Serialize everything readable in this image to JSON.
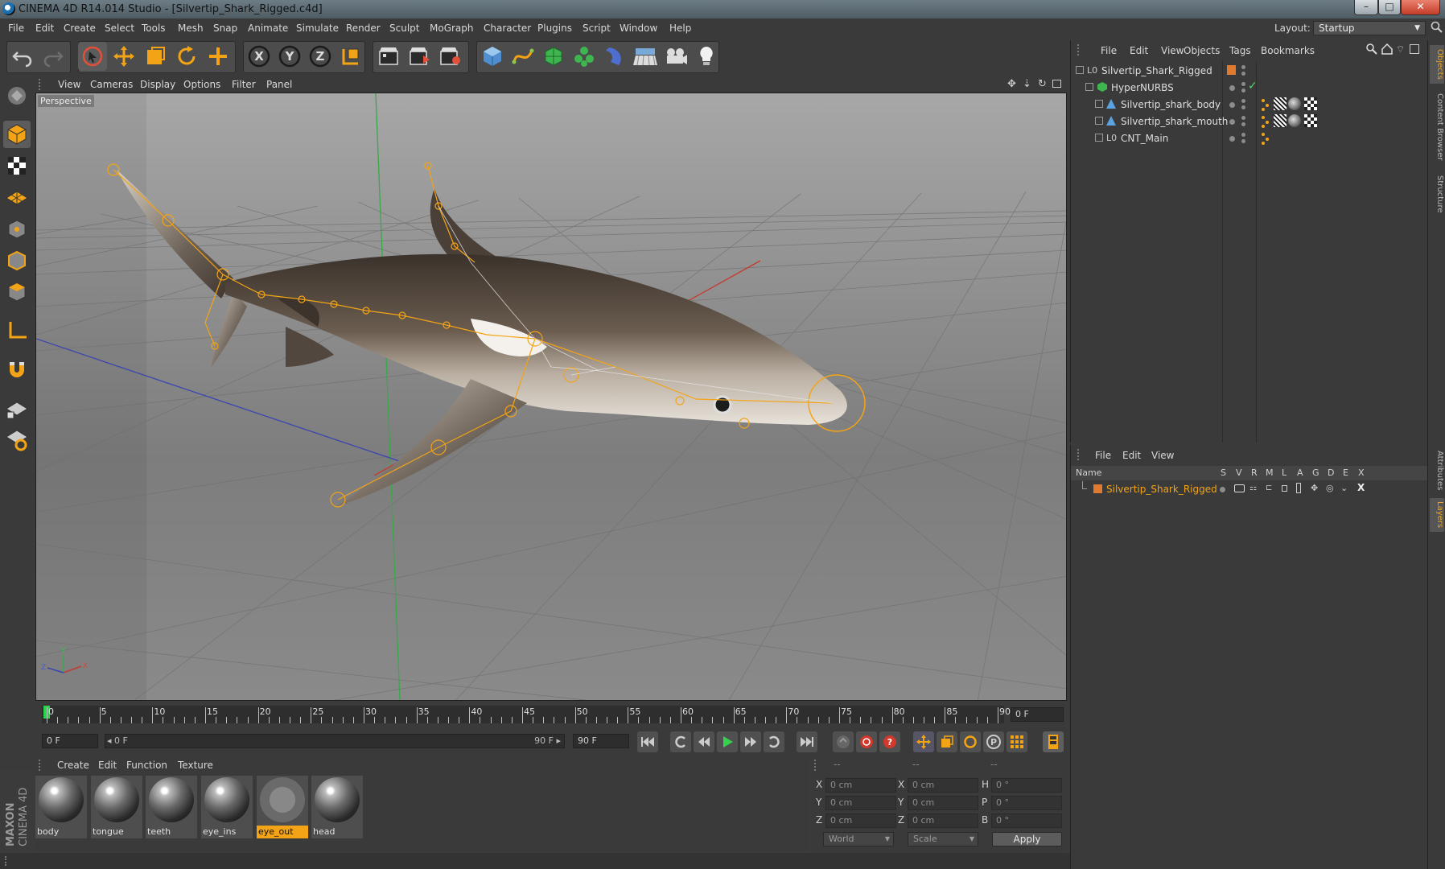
{
  "window": {
    "title": "CINEMA 4D R14.014 Studio - [Silvertip_Shark_Rigged.c4d]",
    "minimize_label": "–",
    "maximize_label": "□",
    "close_label": "✕"
  },
  "menubar": {
    "items": [
      "File",
      "Edit",
      "Create",
      "Select",
      "Tools",
      "Mesh",
      "Snap",
      "Animate",
      "Simulate",
      "Render",
      "Sculpt",
      "MoGraph",
      "Character",
      "Plugins",
      "Script",
      "Window",
      "Help"
    ],
    "layout_label": "Layout:",
    "layout_value": "Startup"
  },
  "toolbar": {
    "icons": [
      "undo-icon",
      "redo-icon",
      "live-select-icon",
      "move-icon",
      "scale-icon",
      "rotate-icon",
      "add-icon",
      "x-axis-icon",
      "y-axis-icon",
      "z-axis-icon",
      "coordinate-system-icon",
      "render-view-icon",
      "render-picture-viewer-icon",
      "render-settings-icon",
      "cube-primitive-icon",
      "spline-pen-icon",
      "nurbs-icon",
      "array-icon",
      "deformer-icon",
      "floor-icon",
      "camera-icon",
      "light-icon"
    ],
    "axis_labels": [
      "X",
      "Y",
      "Z"
    ]
  },
  "leftbar": {
    "icons": [
      "make-editable-icon",
      "model-mode-icon",
      "texture-mode-icon",
      "workplane-icon",
      "points-mode-icon",
      "edges-mode-icon",
      "polygons-mode-icon",
      "axis-mode-icon",
      "magnet-icon",
      "snap-icon",
      "locked-workplane-icon"
    ]
  },
  "viewport": {
    "menu": [
      "View",
      "Cameras",
      "Display",
      "Options",
      "Filter",
      "Panel"
    ],
    "label": "Perspective",
    "axis_labels": {
      "x": "X",
      "y": "Y",
      "z": "Z"
    }
  },
  "timeline": {
    "ticks": [
      "0",
      "5",
      "10",
      "15",
      "20",
      "25",
      "30",
      "35",
      "40",
      "45",
      "50",
      "55",
      "60",
      "65",
      "70",
      "75",
      "80",
      "85",
      "90"
    ],
    "current_frame": "0 F",
    "start_frame": "0 F",
    "range_start": "◂ 0 F",
    "range_end": "90 F ▸",
    "end_frame": "90 F"
  },
  "materials": {
    "menu": [
      "Create",
      "Edit",
      "Function",
      "Texture"
    ],
    "items": [
      {
        "name": "body",
        "selected": false
      },
      {
        "name": "tongue",
        "selected": false
      },
      {
        "name": "teeth",
        "selected": false
      },
      {
        "name": "eye_ins",
        "selected": false
      },
      {
        "name": "eye_out",
        "selected": true
      },
      {
        "name": "head",
        "selected": false
      }
    ]
  },
  "brand": {
    "top": "MAXON",
    "bottom": "CINEMA 4D"
  },
  "coordinates": {
    "headers": [
      "--",
      "--",
      "--"
    ],
    "rows": [
      {
        "l1": "X",
        "v1": "0 cm",
        "l2": "X",
        "v2": "0 cm",
        "l3": "H",
        "v3": "0 °"
      },
      {
        "l1": "Y",
        "v1": "0 cm",
        "l2": "Y",
        "v2": "0 cm",
        "l3": "P",
        "v3": "0 °"
      },
      {
        "l1": "Z",
        "v1": "0 cm",
        "l2": "Z",
        "v2": "0 cm",
        "l3": "B",
        "v3": "0 °"
      }
    ],
    "space": "World",
    "mode": "Scale",
    "apply_label": "Apply"
  },
  "objects": {
    "menu": [
      "File",
      "Edit",
      "View",
      "Objects",
      "Tags",
      "Bookmarks"
    ],
    "items": [
      {
        "name": "Silvertip_Shark_Rigged",
        "icon": "null-object-icon"
      },
      {
        "name": "HyperNURBS",
        "icon": "hypernurbs-icon"
      },
      {
        "name": "Silvertip_shark_body",
        "icon": "polygon-object-icon"
      },
      {
        "name": "Silvertip_shark_mouth",
        "icon": "polygon-object-icon"
      },
      {
        "name": "CNT_Main",
        "icon": "null-object-icon"
      }
    ]
  },
  "layers": {
    "menu": [
      "File",
      "Edit",
      "View"
    ],
    "columns": [
      "Name",
      "S",
      "V",
      "R",
      "M",
      "L",
      "A",
      "G",
      "D",
      "E",
      "X"
    ],
    "rows": [
      {
        "name": "Silvertip_Shark_Rigged",
        "color": "#e07a2e"
      }
    ]
  },
  "vtabs": [
    "Objects",
    "Content Browser",
    "Structure",
    "Attributes",
    "Layers"
  ],
  "colors": {
    "accent": "#f3a416",
    "layer_color": "#e07a2e",
    "shark_body": "#4a4038",
    "bone_orange": "#f3a416"
  }
}
